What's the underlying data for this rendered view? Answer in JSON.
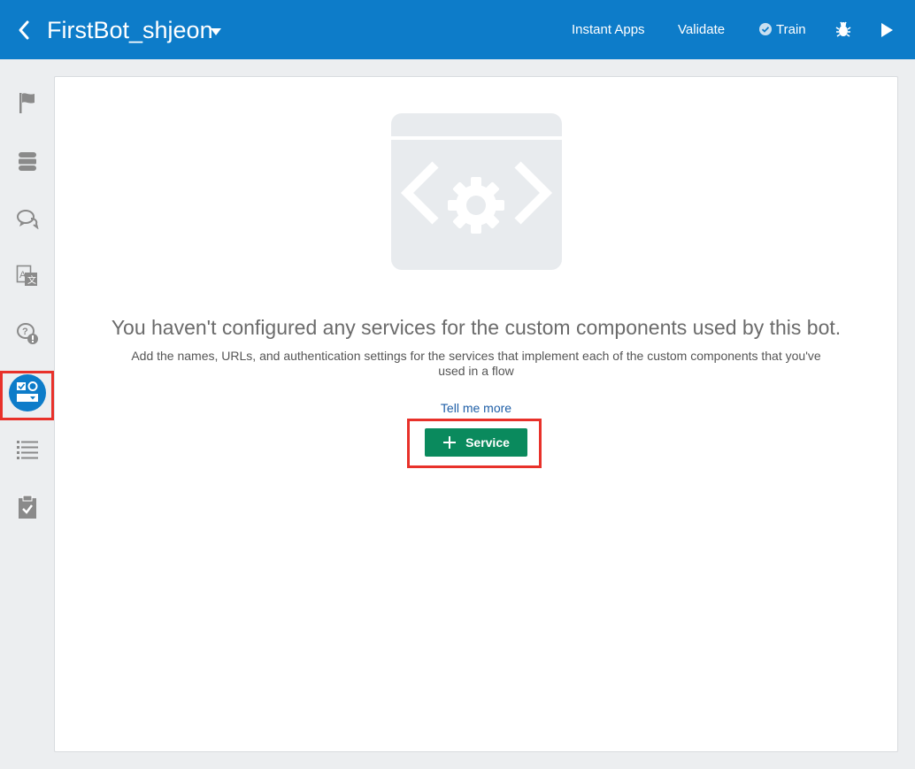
{
  "header": {
    "bot_name": "FirstBot_shjeon",
    "instant_apps_label": "Instant Apps",
    "validate_label": "Validate",
    "train_label": "Train"
  },
  "sidebar": {
    "items": [
      {
        "name": "intents",
        "icon": "flag-icon"
      },
      {
        "name": "entities",
        "icon": "database-icon"
      },
      {
        "name": "flows",
        "icon": "chat-bubbles-icon"
      },
      {
        "name": "resource-bundles",
        "icon": "translate-icon"
      },
      {
        "name": "qna",
        "icon": "question-alert-icon"
      },
      {
        "name": "components",
        "icon": "components-icon",
        "active": true
      },
      {
        "name": "settings",
        "icon": "list-icon"
      },
      {
        "name": "insights",
        "icon": "clipboard-check-icon"
      }
    ]
  },
  "main": {
    "heading": "You haven't configured any services for the custom components used by this bot.",
    "description": "Add the names, URLs, and authentication settings for the services that implement each of the custom components that you've used in a flow",
    "tell_me_more": "Tell me more",
    "service_button_label": "Service"
  },
  "colors": {
    "topbar": "#0d7cc9",
    "highlight": "#e8312a",
    "button": "#0a8a5d",
    "link": "#1f5fa7"
  }
}
